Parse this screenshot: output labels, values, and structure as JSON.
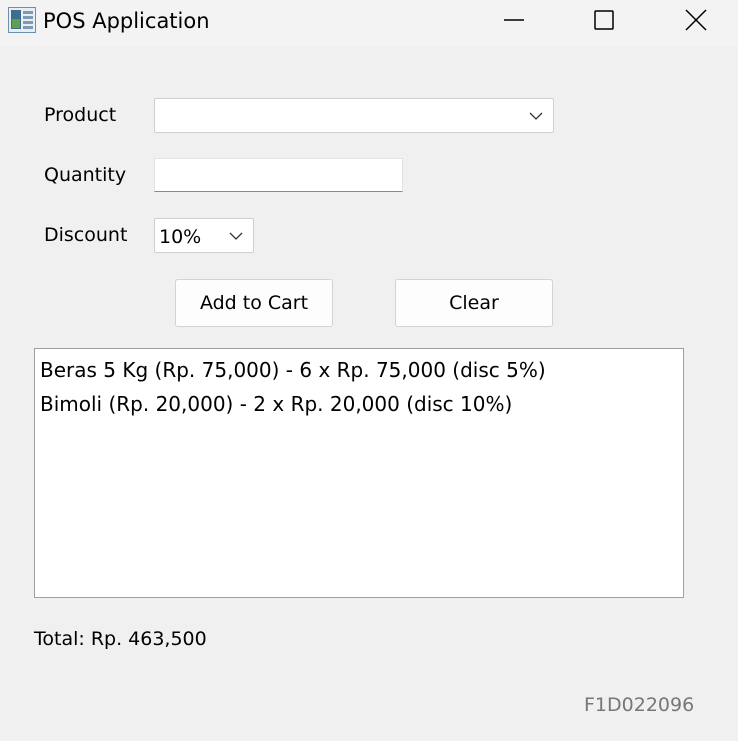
{
  "window": {
    "title": "POS Application",
    "icons": {
      "app": "app-icon",
      "minimize": "minimize-icon",
      "maximize": "maximize-icon",
      "close": "close-icon"
    }
  },
  "form": {
    "product_label": "Product",
    "product_value": "",
    "quantity_label": "Quantity",
    "quantity_value": "",
    "discount_label": "Discount",
    "discount_value": "10%"
  },
  "buttons": {
    "add_to_cart": "Add to Cart",
    "clear": "Clear"
  },
  "cart": {
    "items": [
      "Beras 5 Kg (Rp. 75,000) - 6 x Rp. 75,000 (disc 5%)",
      "Bimoli (Rp. 20,000) - 2 x Rp. 20,000 (disc 10%)"
    ]
  },
  "total_text": "Total: Rp. 463,500",
  "footer_id": "F1D022096"
}
